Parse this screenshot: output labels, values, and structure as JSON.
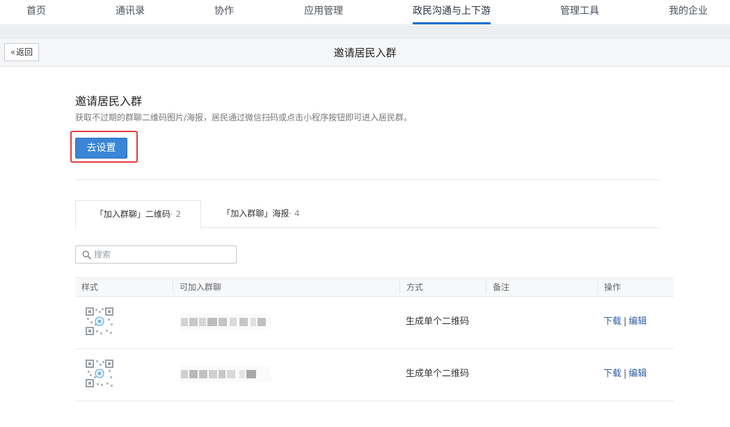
{
  "nav": {
    "items": [
      {
        "label": "首页"
      },
      {
        "label": "通讯录"
      },
      {
        "label": "协作"
      },
      {
        "label": "应用管理"
      },
      {
        "label": "政民沟通与上下游"
      },
      {
        "label": "管理工具"
      },
      {
        "label": "我的企业"
      }
    ],
    "active": "政民沟通与上下游"
  },
  "header": {
    "back_label": "返回",
    "title": "邀请居民入群"
  },
  "intro": {
    "title": "邀请居民入群",
    "description": "获取不过期的群聊二维码图片/海报，居民通过微信扫码或点击小程序按钮即可进入居民群。",
    "setup_button": "去设置"
  },
  "tabs": [
    {
      "label": "「加入群聊」二维码",
      "count": "· 2"
    },
    {
      "label": "「加入群聊」海报",
      "count": "· 4"
    }
  ],
  "search": {
    "placeholder": "搜索",
    "value": ""
  },
  "table": {
    "columns": [
      "样式",
      "可加入群聊",
      "方式",
      "备注",
      "操作"
    ],
    "rows": [
      {
        "chat_name": "",
        "method": "生成单个二维码",
        "note": "",
        "ops": [
          "下载",
          "编辑"
        ]
      },
      {
        "chat_name": "",
        "method": "生成单个二维码",
        "note": "",
        "ops": [
          "下载",
          "编辑"
        ]
      }
    ]
  },
  "colors": {
    "accent": "#1a6fd3",
    "primary_button": "#3a85d6",
    "highlight": "#e23b3b",
    "link": "#2f5fa3"
  }
}
